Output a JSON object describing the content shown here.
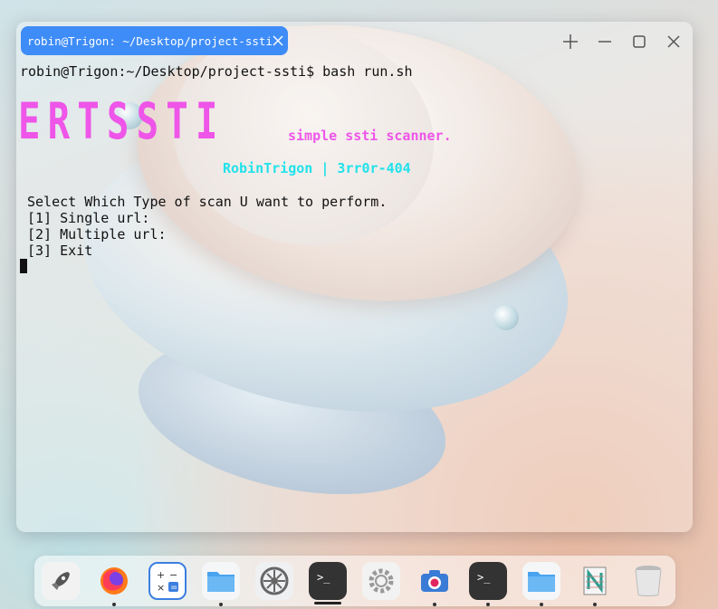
{
  "window": {
    "tab_title": "robin@Trigon: ~/Desktop/project-ssti"
  },
  "terminal": {
    "command_line": "robin@Trigon:~/Desktop/project-ssti$ bash run.sh",
    "banner": "ERTSSTI",
    "tagline": "simple ssti scanner.",
    "author": "RobinTrigon | 3rr0r-404",
    "menu_prompt": "Select Which Type of scan U want to perform.",
    "options": [
      "[1] Single url:",
      "[2] Multiple url:",
      "[3] Exit"
    ]
  },
  "colors": {
    "tab_accent": "#3e8cf7",
    "banner": "#ee55e8",
    "author": "#22e2ea"
  },
  "dock": {
    "items": [
      {
        "icon": "launcher-rocket-icon"
      },
      {
        "icon": "firefox-icon",
        "running": true
      },
      {
        "icon": "calculator-icon"
      },
      {
        "icon": "files-folder-icon",
        "running": true
      },
      {
        "icon": "system-settings-icon"
      },
      {
        "icon": "terminal-icon",
        "active": true
      },
      {
        "icon": "settings-gear-icon"
      },
      {
        "icon": "camera-icon",
        "running": true
      },
      {
        "icon": "terminal-icon",
        "running": true
      },
      {
        "icon": "files-folder-icon",
        "running": true
      },
      {
        "icon": "notes-app-icon",
        "running": true
      },
      {
        "icon": "trash-icon"
      }
    ]
  }
}
